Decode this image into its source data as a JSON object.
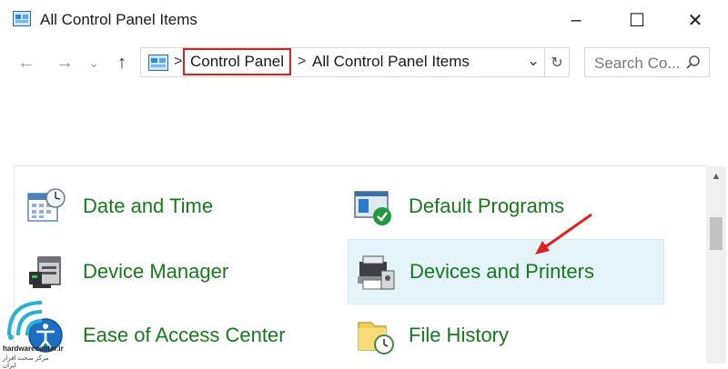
{
  "window": {
    "title": "All Control Panel Items",
    "controls": {
      "minimize": "–",
      "maximize": "☐",
      "close": "✕"
    }
  },
  "nav": {
    "back": "←",
    "forward": "→",
    "recent": "⌄",
    "up": "↑"
  },
  "address": {
    "separator": ">",
    "crumbs": [
      "Control Panel",
      "All Control Panel Items"
    ],
    "dropdown": "⌄",
    "refresh": "↻"
  },
  "search": {
    "placeholder": "Search Co..."
  },
  "items": [
    {
      "label": "Date and Time",
      "icon": "calendar-clock-icon"
    },
    {
      "label": "Default Programs",
      "icon": "default-programs-icon"
    },
    {
      "label": "Device Manager",
      "icon": "device-manager-icon"
    },
    {
      "label": "Devices and Printers",
      "icon": "printer-icon",
      "selected": true
    },
    {
      "label": "Ease of Access Center",
      "icon": "ease-of-access-icon"
    },
    {
      "label": "File History",
      "icon": "file-history-icon"
    }
  ],
  "watermark": {
    "site": "hardwarecenter.ir",
    "tagline": "مرکز سخت افزار ایران"
  },
  "colors": {
    "link": "#17791c",
    "highlight_box": "#e02020",
    "arrow": "#e02020",
    "selection": "#e5f3fb"
  }
}
